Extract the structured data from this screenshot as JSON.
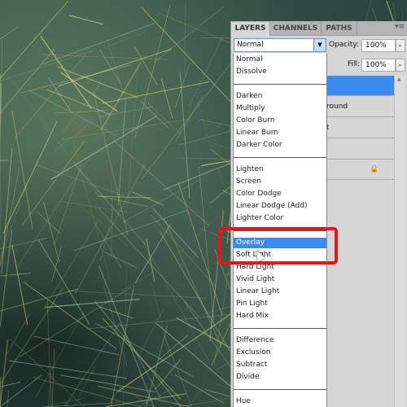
{
  "panel": {
    "tabs": [
      "LAYERS",
      "CHANNELS",
      "PATHS"
    ],
    "blend_mode": "Normal",
    "opacity_label": "Opacity:",
    "opacity": "100%",
    "fill_label": "Fill:",
    "fill": "100%",
    "layers": [
      "",
      "round",
      "t",
      "",
      ""
    ]
  },
  "dropdown": {
    "groups": [
      [
        "Normal",
        "Dissolve"
      ],
      [
        "Darken",
        "Multiply",
        "Color Burn",
        "Linear Burn",
        "Darker Color"
      ],
      [
        "Lighten",
        "Screen",
        "Color Dodge",
        "Linear Dodge (Add)",
        "Lighter Color"
      ],
      [
        "Overlay",
        "Soft Light",
        "Hard Light",
        "Vivid Light",
        "Linear Light",
        "Pin Light",
        "Hard Mix"
      ],
      [
        "Difference",
        "Exclusion",
        "Subtract",
        "Divide"
      ],
      [
        "Hue"
      ]
    ],
    "highlighted": "Overlay"
  },
  "colors": {
    "highlight": "#3c8cf0",
    "annotation": "#e8141c"
  }
}
